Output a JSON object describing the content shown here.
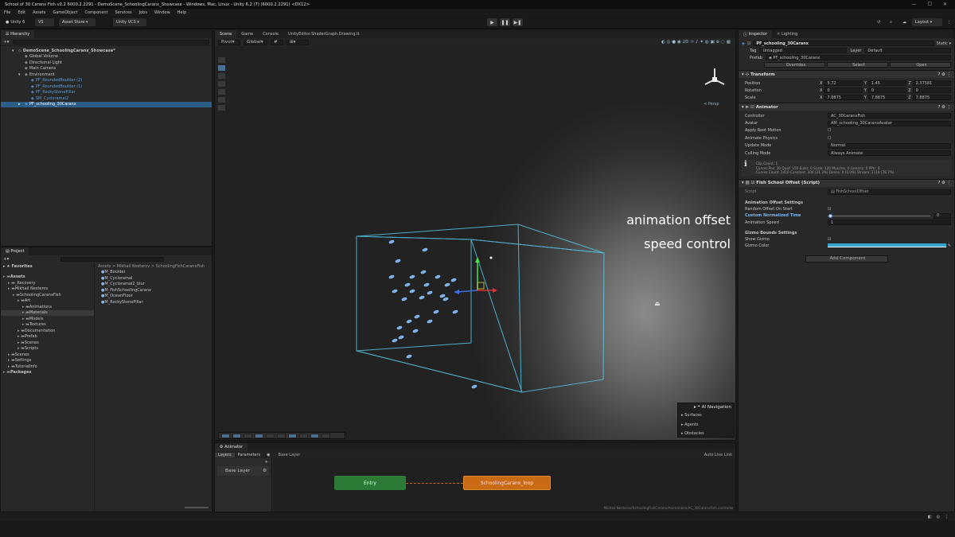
{
  "window": {
    "title": "School of 30 Caranx Fish v2.2 6000.2.2291 - DemoScene_SchoolingCaranx_Showcase - Windows, Mac, Linux - Unity 6.2 (7) (6000.2.2291) <DX12>",
    "controls": [
      "—",
      "☐",
      "✕"
    ]
  },
  "menu": [
    "File",
    "Edit",
    "Assets",
    "GameObject",
    "Component",
    "Services",
    "Jobs",
    "Window",
    "Help"
  ],
  "toolbar": {
    "account": "Unity 6",
    "vcs": "VS",
    "asset_store": "Asset Store ▾",
    "unity_vcs": "Unity VCS ▾",
    "layout": "Layout"
  },
  "hierarchy": {
    "tab": "Hierarchy",
    "items": [
      {
        "label": "DemoScene_SchoolingCaranx_Showcase*",
        "indent": 0,
        "style": "scene",
        "arrow": "▾"
      },
      {
        "label": "Global Volume",
        "indent": 1,
        "style": "normal",
        "arrow": ""
      },
      {
        "label": "Directional Light",
        "indent": 1,
        "style": "normal",
        "arrow": ""
      },
      {
        "label": "Main Camera",
        "indent": 1,
        "style": "normal",
        "arrow": ""
      },
      {
        "label": "Environment",
        "indent": 1,
        "style": "normal",
        "arrow": "▾"
      },
      {
        "label": "PF_RoundedBoulder (2)",
        "indent": 2,
        "style": "prefab",
        "arrow": ""
      },
      {
        "label": "PF_RoundedBoulder (1)",
        "indent": 2,
        "style": "prefab",
        "arrow": ""
      },
      {
        "label": "PF_RockyStonePillar",
        "indent": 2,
        "style": "prefab",
        "arrow": ""
      },
      {
        "label": "SM_Cycloramal2",
        "indent": 2,
        "style": "prefab",
        "arrow": ""
      },
      {
        "label": "PF_schooling_30Caranx",
        "indent": 1,
        "style": "selected",
        "arrow": "▸"
      }
    ]
  },
  "project": {
    "tab": "Project",
    "favorites": "Favorites",
    "breadcrumb": "Assets > Mikhail Nesterov > SchoolingFishCaranxFish",
    "tree": [
      {
        "label": "Assets",
        "indent": 0
      },
      {
        "label": "_Recovery",
        "indent": 1
      },
      {
        "label": "Mikhail Nesterov",
        "indent": 1
      },
      {
        "label": "SchoolingCaranxFish",
        "indent": 2
      },
      {
        "label": "Art",
        "indent": 3
      },
      {
        "label": "Animations",
        "indent": 4
      },
      {
        "label": "Materials",
        "indent": 4
      },
      {
        "label": "Models",
        "indent": 4
      },
      {
        "label": "Textures",
        "indent": 4
      },
      {
        "label": "Documentation",
        "indent": 3
      },
      {
        "label": "Prefab",
        "indent": 3
      },
      {
        "label": "Scenes",
        "indent": 3
      },
      {
        "label": "Scripts",
        "indent": 3
      },
      {
        "label": "Scenes",
        "indent": 1
      },
      {
        "label": "Settings",
        "indent": 1
      },
      {
        "label": "TutorialInfo",
        "indent": 1
      },
      {
        "label": "Packages",
        "indent": 0
      }
    ],
    "files": [
      "M_Boulder",
      "M_Cycloramal",
      "M_Cycloramal2_blur",
      "M_FishSchoolingCaranx",
      "M_OceanFloor",
      "M_RockyStonePillar"
    ]
  },
  "scene": {
    "tabs": [
      "Scene",
      "Game",
      "Console",
      "UnityEditor.ShaderGraph.Drawing.It"
    ],
    "pivot": "Pivot",
    "global": "Global",
    "persp": "< Persp",
    "overlay": {
      "title": "AI Navigation",
      "items": [
        "Surfaces",
        "Agents",
        "Obstacles"
      ]
    }
  },
  "overlay_text": [
    "animation offset",
    "speed control"
  ],
  "animator": {
    "tab": "Animator",
    "layers": "Layers",
    "parameters": "Parameters",
    "base_layer": "Base Layer",
    "auto_live": "Auto Live Link",
    "entry": "Entry",
    "state": "SchoolingCaranx_loop",
    "path": "Mikhail Nesterov/SchoolingFishCaranx/Animations/AC_30CaranxFish.controller"
  },
  "inspector": {
    "tabs": [
      "Inspector",
      "Lighting"
    ],
    "object_name": "PF_schooling_30Caranx",
    "static": "Static",
    "tag_label": "Tag",
    "tag": "Untagged",
    "layer_label": "Layer",
    "layer": "Default",
    "prefab_label": "Prefab",
    "prefab": "PF_schooling_30Caranx",
    "prefab_buttons": [
      "Overrides",
      "Select",
      "Open"
    ],
    "transform": {
      "title": "Transform",
      "rows": [
        {
          "label": "Position",
          "x": "5.72",
          "y": "1.45",
          "z": "2.37581"
        },
        {
          "label": "Rotation",
          "x": "0",
          "y": "0",
          "z": "0"
        },
        {
          "label": "Scale",
          "x": "7.8875",
          "y": "7.8875",
          "z": "7.8875"
        }
      ]
    },
    "animator": {
      "title": "Animator",
      "rows": [
        {
          "label": "Controller",
          "value": "AC_30CaranxFish"
        },
        {
          "label": "Avatar",
          "value": "AM_schooling_30CaranxAvatar"
        },
        {
          "label": "Apply Root Motion",
          "value": ""
        },
        {
          "label": "Animate Physics",
          "value": ""
        },
        {
          "label": "Update Mode",
          "value": "Normal"
        },
        {
          "label": "Culling Mode",
          "value": "Always Animate"
        }
      ],
      "info": [
        "Clip Count: 1",
        "Curves Pos: 30 Quat: 150 Euler: 0 Scale: 120 Muscles: 0 Generic: 0 PPtr: 0",
        "Curves Count: 1410 Constant: 300 (21.3%) Dense: 0 (0.0%) Stream: 1110 (78.7%)"
      ]
    },
    "script": {
      "title": "Fish School Offset (Script)",
      "script_label": "Script",
      "script_value": "FishSchoolOffset",
      "section1": "Animation Offset Settings",
      "random_offset": "Random Offset On Start",
      "custom_time": "Custom Normalized Time",
      "custom_time_value": "0",
      "speed_label": "Animation Speed",
      "speed_value": "1",
      "section2": "Gizmo Bounds Settings",
      "show_gizmo": "Show Gizmo",
      "gizmo_color": "Gizmo Color"
    },
    "add_component": "Add Component"
  },
  "colors": {
    "gizmo": "#37a5cf",
    "entry": "#2c7a35",
    "state": "#c96a14",
    "selection": "#2c5d87"
  }
}
